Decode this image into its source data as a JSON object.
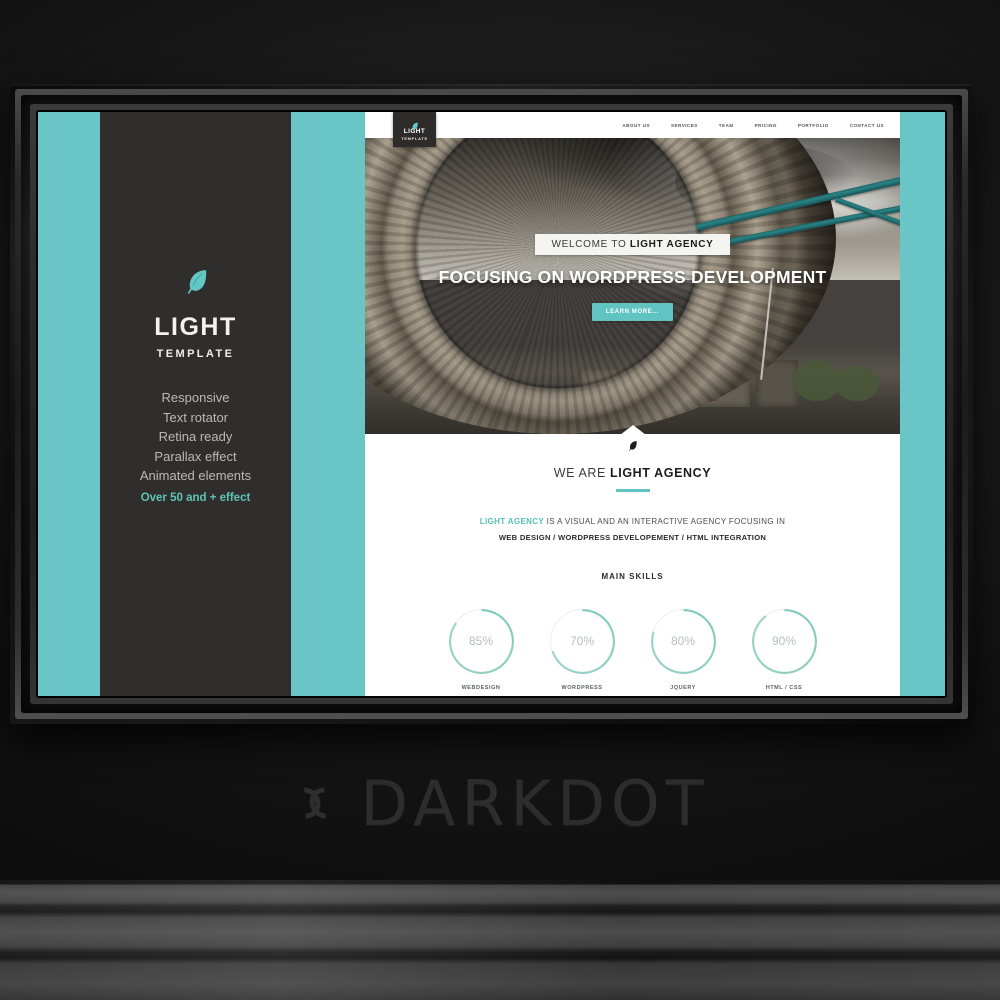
{
  "watermark": {
    "text": "DARKDOT",
    "mark": "darkdot-logo-mark"
  },
  "colors": {
    "teal": "#6ac6c6",
    "panel_dark": "#302e2c",
    "accent_text": "#5ec4b8",
    "button": "#62c4c2",
    "frame_black": "#111111"
  },
  "promo_panel": {
    "icon": "feather-icon",
    "title": "LIGHT",
    "subtitle": "TEMPLATE",
    "features": [
      "Responsive",
      "Text rotator",
      "Retina ready",
      "Parallax effect",
      "Animated elements"
    ],
    "highlight": "Over 50 and + effect"
  },
  "site": {
    "logo": {
      "icon": "feather-icon",
      "title": "LIGHT",
      "subtitle": "TEMPLATE"
    },
    "nav": [
      {
        "label": "ABOUT US"
      },
      {
        "label": "SERVICES"
      },
      {
        "label": "TEAM"
      },
      {
        "label": "PRICING"
      },
      {
        "label": "PORTFOLIO"
      },
      {
        "label": "CONTACT US"
      }
    ],
    "hero": {
      "badge_prefix": "WELCOME TO ",
      "badge_brand": "LIGHT AGENCY",
      "headline": "FOCUSING ON WORDPRESS DEVELOPMENT",
      "cta_label": "LEARN MORE...",
      "image_alt": "tower-bridge-fisheye-photo"
    },
    "about": {
      "heading_prefix": "WE ARE ",
      "heading_brand": "LIGHT AGENCY",
      "desc_brand": "LIGHT AGENCY",
      "desc_rest": " IS A VISUAL AND AN INTERACTIVE AGENCY FOCUSING IN",
      "desc_line2": "WEB DESIGN / WORDPRESS DEVELOPEMENT / HTML INTEGRATION",
      "skills_title": "MAIN SKILLS"
    },
    "skills": [
      {
        "label": "WEBDESIGN",
        "percent": 85,
        "value": "85%"
      },
      {
        "label": "WORDPRESS",
        "percent": 70,
        "value": "70%"
      },
      {
        "label": "JQUERY",
        "percent": 80,
        "value": "80%"
      },
      {
        "label": "HTML / CSS",
        "percent": 90,
        "value": "90%"
      }
    ]
  }
}
